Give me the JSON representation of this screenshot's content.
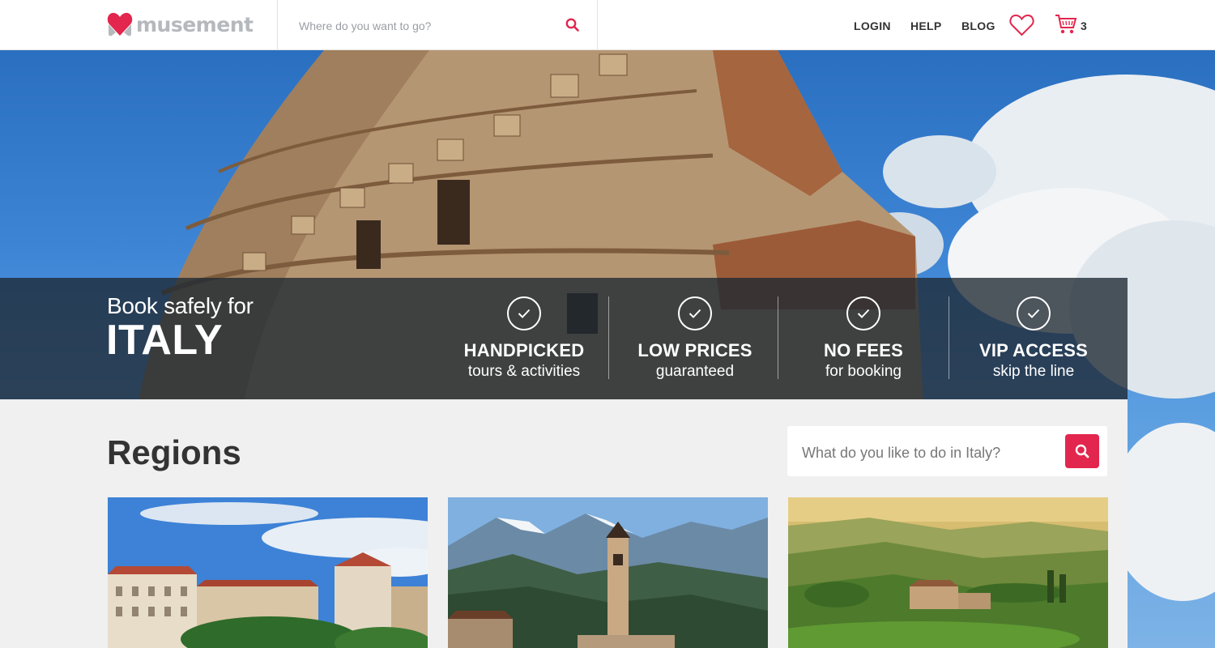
{
  "brand": {
    "name": "musement",
    "accent": "#e2264d"
  },
  "header": {
    "search_placeholder": "Where do you want to go?",
    "nav": {
      "login": "LOGIN",
      "help": "HELP",
      "blog": "BLOG"
    },
    "cart_count": "3"
  },
  "banner": {
    "tagline": "Book safely for",
    "country": "ITALY",
    "features": [
      {
        "title": "HANDPICKED",
        "subtitle": "tours & activities"
      },
      {
        "title": "LOW PRICES",
        "subtitle": "guaranteed"
      },
      {
        "title": "NO FEES",
        "subtitle": "for booking"
      },
      {
        "title": "VIP ACCESS",
        "subtitle": "skip the line"
      }
    ]
  },
  "regions": {
    "title": "Regions",
    "search_placeholder": "What do you like to do in Italy?"
  },
  "icons": [
    "heart-logo-icon",
    "search-icon",
    "heart-icon",
    "cart-icon",
    "check-icon"
  ]
}
